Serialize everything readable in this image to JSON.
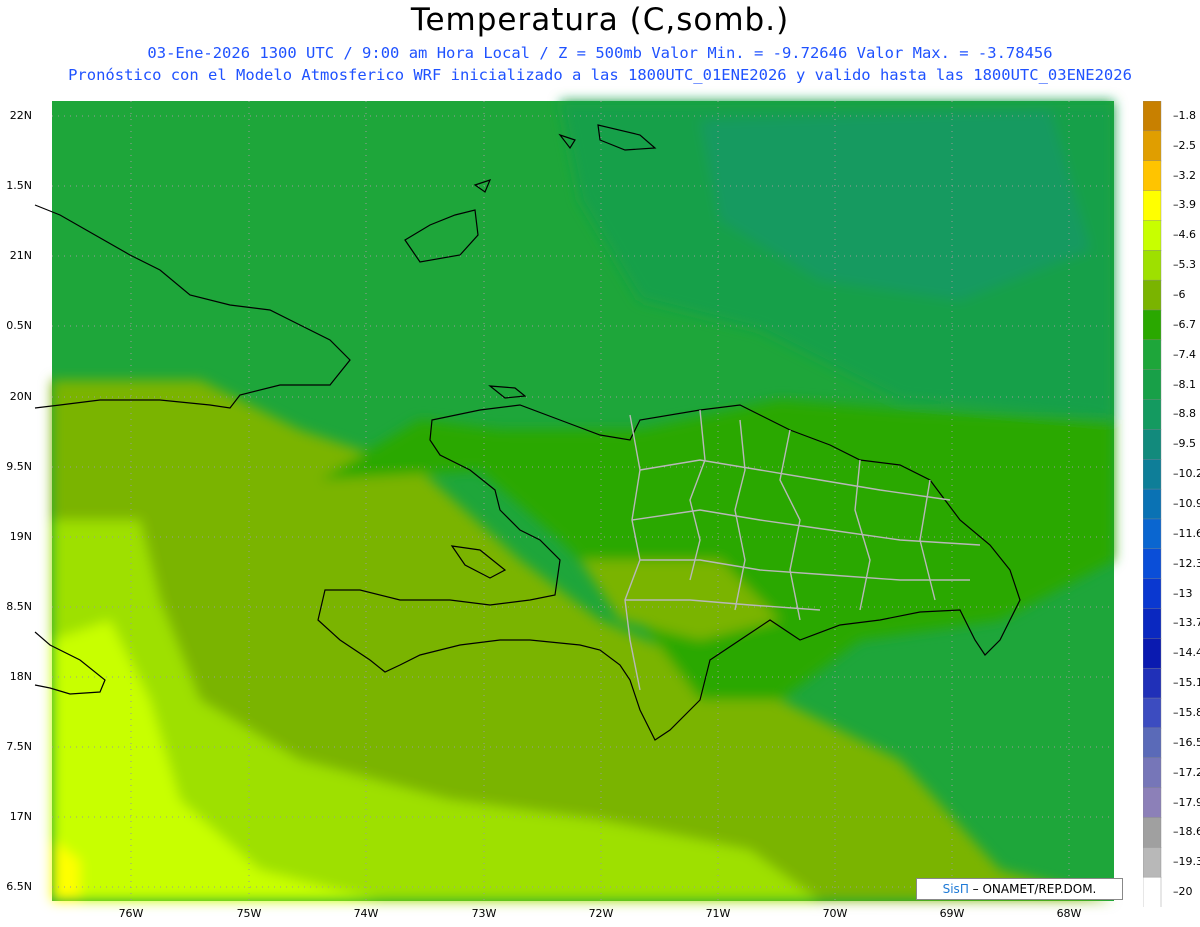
{
  "header": {
    "title": "Temperatura (C,somb.)",
    "line1": "03-Ene-2026  1300 UTC / 9:00 am Hora Local / Z = 500mb  Valor Min. = -9.72646  Valor Max. = -3.78456",
    "line2": "Pronóstico con el Modelo Atmosferico WRF inicializado a las 1800UTC_01ENE2026 y valido hasta las  1800UTC_03ENE2026"
  },
  "axes": {
    "lat_labels": [
      "22N",
      "1.5N",
      "21N",
      "0.5N",
      "20N",
      "9.5N",
      "19N",
      "8.5N",
      "18N",
      "7.5N",
      "17N",
      "6.5N"
    ],
    "lon_labels": [
      "76W",
      "75W",
      "74W",
      "73W",
      "72W",
      "71W",
      "70W",
      "69W",
      "68W"
    ]
  },
  "colorbar": {
    "labels": [
      "-1.8",
      "-2.5",
      "-3.2",
      "-3.9",
      "-4.6",
      "-5.3",
      "-6",
      "-6.7",
      "-7.4",
      "-8.1",
      "-8.8",
      "-9.5",
      "-10.2",
      "-10.9",
      "-11.6",
      "-12.3",
      "-13",
      "-13.7",
      "-14.4",
      "-15.1",
      "-15.8",
      "-16.5",
      "-17.2",
      "-17.9",
      "-18.6",
      "-19.3",
      "-20"
    ],
    "colors": [
      "#c88000",
      "#e09e00",
      "#ffc400",
      "#ffff00",
      "#c8ff00",
      "#9ee000",
      "#7ab400",
      "#2aa800",
      "#1ea63a",
      "#18a048",
      "#149a60",
      "#128a7c",
      "#0e7e98",
      "#0a72b4",
      "#0a66d0",
      "#0a4ed8",
      "#0a38d0",
      "#0a28c0",
      "#0a1ab0",
      "#2030b8",
      "#3c4cc0",
      "#5a6ab8",
      "#7676b8",
      "#8c80b8",
      "#a0a0a0",
      "#b8b8b8",
      "#ffffff"
    ]
  },
  "credit": {
    "brand": "SisΠ",
    "text": " – ONAMET/REP.DOM."
  }
}
